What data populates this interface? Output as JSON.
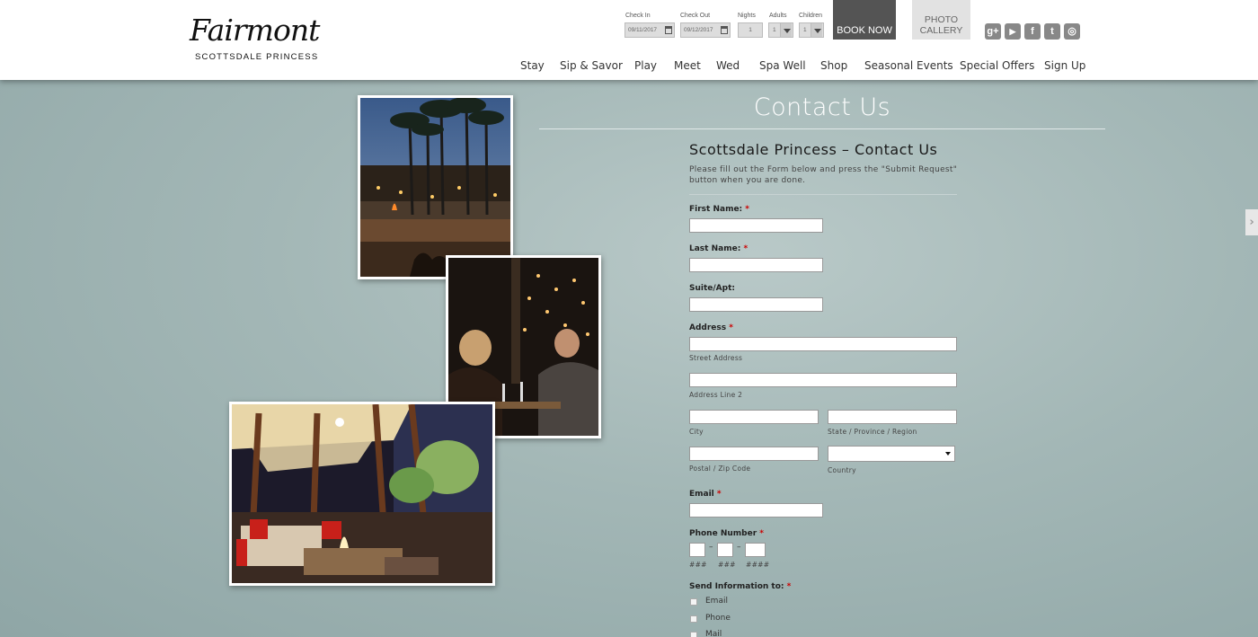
{
  "brand": {
    "logo_script": "Fairmont",
    "logo_sub": "SCOTTSDALE PRINCESS"
  },
  "booking": {
    "check_in_label": "Check In",
    "check_in_value": "09/11/2017",
    "check_out_label": "Check Out",
    "check_out_value": "09/12/2017",
    "nights_label": "Nights",
    "nights_value": "1",
    "adults_label": "Adults",
    "adults_value": "1",
    "children_label": "Children",
    "children_value": "1",
    "book_now": "BOOK NOW",
    "photo_gallery_line1": "PHOTO",
    "photo_gallery_line2": "CALLERY"
  },
  "social": [
    {
      "icon": "google-plus-icon",
      "glyph": "g+"
    },
    {
      "icon": "youtube-icon",
      "glyph": "▶"
    },
    {
      "icon": "facebook-icon",
      "glyph": "f"
    },
    {
      "icon": "twitter-icon",
      "glyph": "t"
    },
    {
      "icon": "instagram-icon",
      "glyph": "◎"
    }
  ],
  "nav": [
    "Stay",
    "Sip & Savor",
    "Play",
    "Meet",
    "Wed",
    "Spa Well",
    "Shop",
    "Seasonal Events",
    "Special Offers",
    "Sign Up"
  ],
  "page": {
    "title": "Contact Us"
  },
  "form": {
    "title": "Scottsdale Princess – Contact Us",
    "description": "Please fill out the Form below and press the \"Submit Request\" button when you are done.",
    "first_name_label": "First Name:",
    "last_name_label": "Last Name:",
    "suite_label": "Suite/Apt:",
    "address_label": "Address",
    "street_address_sub": "Street Address",
    "address_line2_sub": "Address Line 2",
    "city_sub": "City",
    "state_sub": "State / Province / Region",
    "postal_sub": "Postal / Zip Code",
    "country_sub": "Country",
    "email_label": "Email",
    "phone_label": "Phone Number",
    "phone_sub1": "###",
    "phone_sub2": "###",
    "phone_sub3": "####",
    "phone_dash": "–",
    "send_info_label": "Send Information to:",
    "required_mark": "*",
    "send_options": [
      "Email",
      "Phone",
      "Mail"
    ]
  },
  "colors": {
    "header_bg": "#ffffff",
    "book_now_bg": "#545454",
    "gallery_bg": "#e2e2e2",
    "required": "#cc0000",
    "page_bg": "#a3b7b6"
  }
}
